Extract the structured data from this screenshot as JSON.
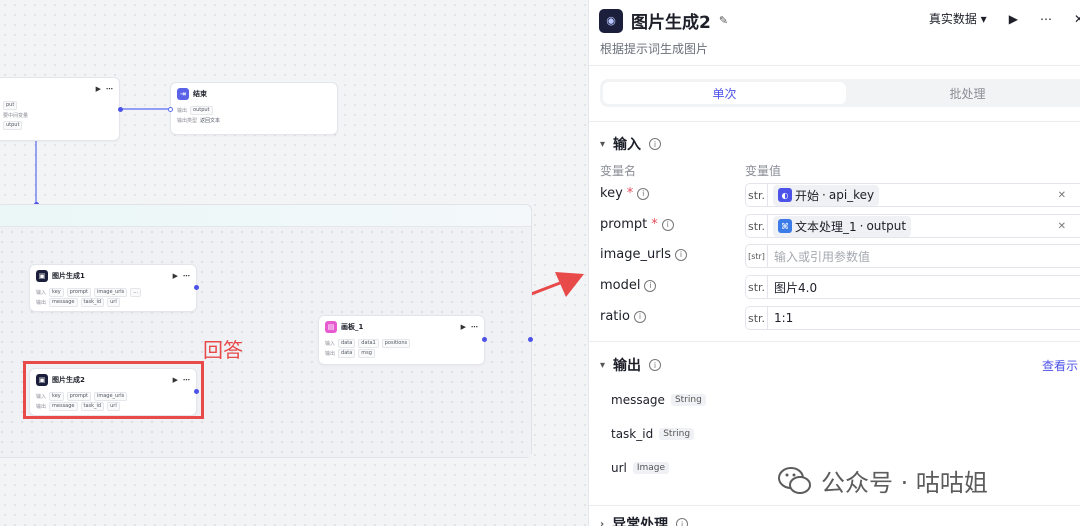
{
  "canvas": {
    "top_node": {
      "rows": [
        "put",
        "要中间变量",
        "utput"
      ]
    },
    "end_node": {
      "title": "结束",
      "row1_label": "输出",
      "row1_tag": "output",
      "row2_label": "输出类型",
      "row2_value": "返回文本"
    },
    "gen1": {
      "title": "图片生成1",
      "in_label": "输入",
      "inputs": [
        "key",
        "prompt",
        "image_urls",
        "..."
      ],
      "out_label": "输出",
      "outputs": [
        "message",
        "task_id",
        "url"
      ]
    },
    "gen2": {
      "title": "图片生成2",
      "in_label": "输入",
      "inputs": [
        "key",
        "prompt",
        "image_urls"
      ],
      "out_label": "输出",
      "outputs": [
        "message",
        "task_id",
        "url"
      ]
    },
    "board": {
      "title": "画板_1",
      "in_label": "输入",
      "inputs": [
        "data",
        "data1",
        "positions"
      ],
      "out_label": "输出",
      "outputs": [
        "data",
        "msg"
      ]
    },
    "annotation": "回答"
  },
  "panel": {
    "title": "图片生成2",
    "subtitle": "根据提示词生成图片",
    "data_mode": "真实数据",
    "tabs": [
      "单次",
      "批处理"
    ],
    "input_section": "输入",
    "col_name": "变量名",
    "col_value": "变量值",
    "inputs": [
      {
        "name": "key",
        "required": true,
        "type": "str.",
        "chip_source": "开始",
        "chip_var": "api_key",
        "chip_color": "#4d53e8"
      },
      {
        "name": "prompt",
        "required": true,
        "type": "str.",
        "chip_source": "文本处理_1",
        "chip_var": "output",
        "chip_color": "#3c7ce8"
      },
      {
        "name": "image_urls",
        "required": false,
        "type": "[str]",
        "placeholder": "输入或引用参数值"
      },
      {
        "name": "model",
        "required": false,
        "type": "str.",
        "value": "图片4.0"
      },
      {
        "name": "ratio",
        "required": false,
        "type": "str.",
        "value": "1:1"
      }
    ],
    "output_section": "输出",
    "view_link": "查看示",
    "outputs": [
      {
        "name": "message",
        "type": "String"
      },
      {
        "name": "task_id",
        "type": "String"
      },
      {
        "name": "url",
        "type": "Image"
      }
    ],
    "exception_section": "异常处理"
  },
  "watermark": "公众号 · 咕咕姐",
  "colors": {
    "accent": "#4d53e8",
    "annotation": "#e84a4a",
    "edge": "#5a6cf0"
  }
}
